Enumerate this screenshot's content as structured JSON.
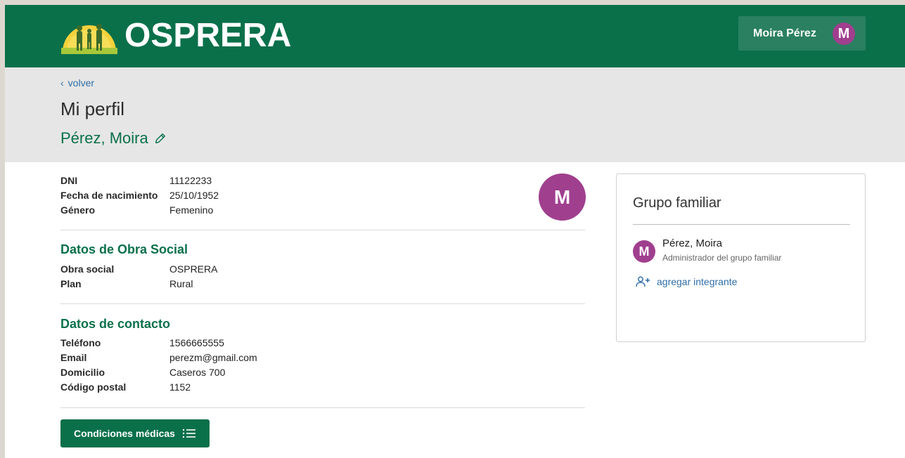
{
  "header": {
    "brand": "OSPRERA",
    "user_name": "Moira Pérez",
    "user_initial": "M"
  },
  "nav": {
    "back_label": "volver"
  },
  "page": {
    "title": "Mi perfil",
    "person_name": "Pérez, Moira",
    "avatar_initial": "M"
  },
  "personal": {
    "rows": [
      {
        "label": "DNI",
        "value": "11122233"
      },
      {
        "label": "Fecha de nacimiento",
        "value": "25/10/1952"
      },
      {
        "label": "Género",
        "value": "Femenino"
      }
    ]
  },
  "obra_social": {
    "title": "Datos de Obra Social",
    "rows": [
      {
        "label": "Obra social",
        "value": "OSPRERA"
      },
      {
        "label": "Plan",
        "value": "Rural"
      }
    ]
  },
  "contacto": {
    "title": "Datos de contacto",
    "rows": [
      {
        "label": "Teléfono",
        "value": "1566665555"
      },
      {
        "label": "Email",
        "value": "perezm@gmail.com"
      },
      {
        "label": "Domicilio",
        "value": "Caseros 700"
      },
      {
        "label": "Código postal",
        "value": "1152"
      }
    ]
  },
  "actions": {
    "condiciones_label": "Condiciones médicas"
  },
  "grupo": {
    "title": "Grupo familiar",
    "members": [
      {
        "initial": "M",
        "name": "Pérez, Moira",
        "role": "Administrador del grupo familiar"
      }
    ],
    "add_label": "agregar integrante"
  },
  "colors": {
    "brand_green": "#0a704a",
    "avatar_purple": "#a03f8e",
    "link_blue": "#2f6ea8"
  }
}
